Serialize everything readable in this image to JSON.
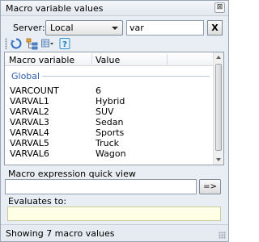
{
  "window": {
    "title": "Macro variable values",
    "close_glyph": "⊠"
  },
  "server": {
    "label": "Server:",
    "selected": "Local",
    "filter_value": "var",
    "clear_label": "X"
  },
  "toolbar": {
    "icons": [
      "refresh-icon",
      "tree-view-icon",
      "grid-options-icon",
      "help-icon"
    ]
  },
  "list": {
    "columns": [
      "Macro variable",
      "Value"
    ],
    "group": "Global",
    "rows": [
      {
        "name": "VARCOUNT",
        "value": "6"
      },
      {
        "name": "VARVAL1",
        "value": "Hybrid"
      },
      {
        "name": "VARVAL2",
        "value": "SUV"
      },
      {
        "name": "VARVAL3",
        "value": "Sedan"
      },
      {
        "name": "VARVAL4",
        "value": "Sports"
      },
      {
        "name": "VARVAL5",
        "value": "Truck"
      },
      {
        "name": "VARVAL6",
        "value": "Wagon"
      }
    ]
  },
  "quickview": {
    "label": "Macro expression quick view",
    "value": "",
    "go_label": "=>"
  },
  "evaluates": {
    "label": "Evaluates to:",
    "value": ""
  },
  "status": {
    "text": "Showing 7 macro values"
  },
  "colors": {
    "group_header": "#2a5fb0",
    "evaluates_bg": "#ffffe6"
  }
}
